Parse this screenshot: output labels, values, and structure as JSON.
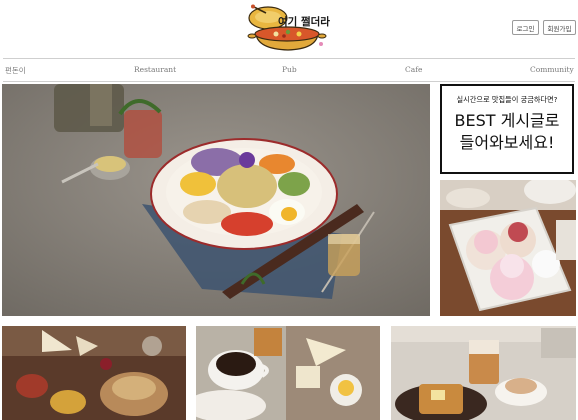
{
  "header": {
    "logo_text": "여기 쩔더라",
    "login_label": "로그인",
    "signup_label": "회원가입"
  },
  "nav": {
    "items": [
      "펀돈이",
      "Restaurant",
      "Pub",
      "Cafe",
      "Community"
    ]
  },
  "best": {
    "subtitle": "실시간으로 맛집들이 궁금하다면?",
    "title_line1": "BEST 게시글로",
    "title_line2": "들어와보세요!"
  },
  "colors": {
    "border": "#111111",
    "nav_text": "#7a7a7a",
    "logo_pot": "#e2a93b",
    "logo_text": "#1a1a1a"
  }
}
